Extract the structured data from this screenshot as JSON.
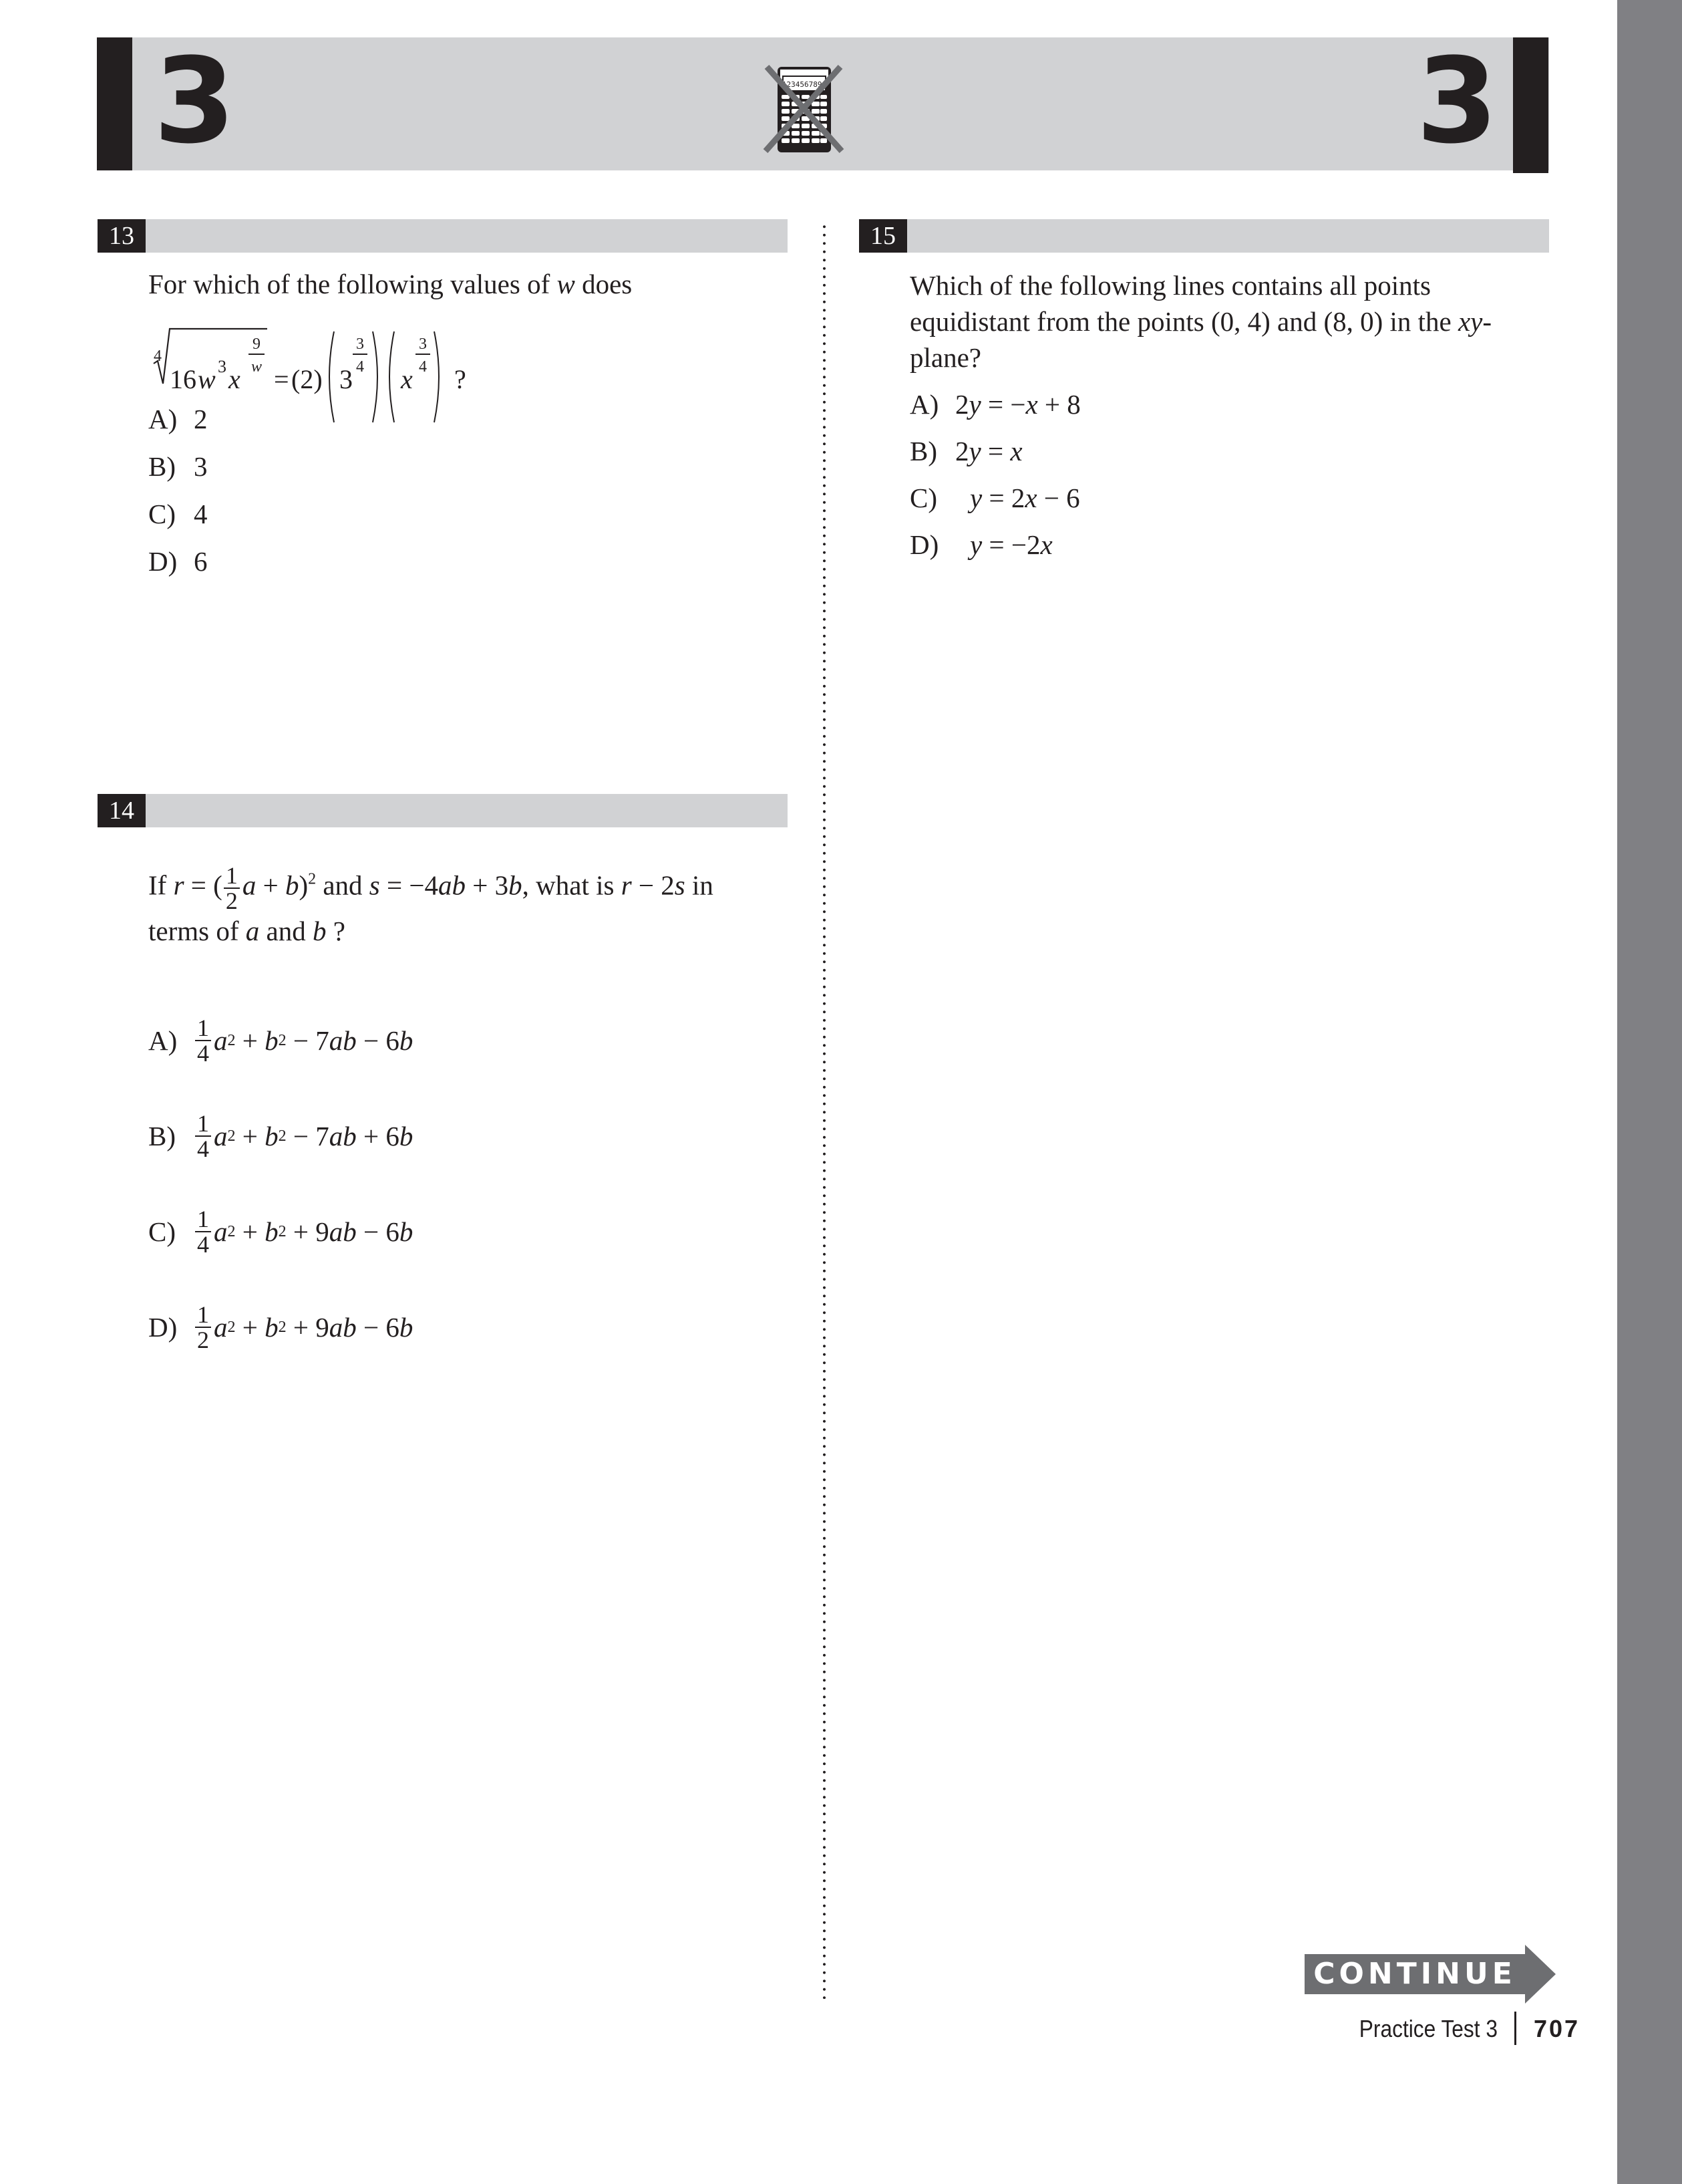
{
  "header": {
    "section_number_left": "3",
    "section_number_right": "3",
    "calculator_icon": "no-calculator-icon",
    "calculator_display": "1234567890"
  },
  "questions": [
    {
      "number": "13",
      "stem": "For which of the following values of w does",
      "stem_parts": [
        "For which of the following values of ",
        "w",
        " does"
      ],
      "equation": {
        "root_index": "4",
        "radicand_coefficient": "16",
        "radicand_var1": "w",
        "radicand_var1_exp": "3",
        "radicand_var2": "x",
        "radicand_var2_exp_num": "9",
        "radicand_var2_exp_den": "w",
        "equals": "=",
        "factor1": "(2)",
        "factor2_base": "3",
        "factor2_exp_num": "3",
        "factor2_exp_den": "4",
        "factor3_base": "x",
        "factor3_exp_num": "3",
        "factor3_exp_den": "4",
        "end": "?"
      },
      "choices": [
        {
          "label": "A)",
          "text": "2"
        },
        {
          "label": "B)",
          "text": "3"
        },
        {
          "label": "C)",
          "text": "4"
        },
        {
          "label": "D)",
          "text": "6"
        }
      ]
    },
    {
      "number": "14",
      "stem": "If r = (1/2 a + b)² and s = −4ab + 3b, what is r − 2s in terms of a and b ?",
      "stem_parts": {
        "p1": "If ",
        "r": "r",
        "p2": " = (",
        "frac_num": "1",
        "frac_den": "2",
        "a1": "a",
        "p3": " + ",
        "b1": "b",
        "p4": ")",
        "sq": "2",
        "p5": " and ",
        "s": "s",
        "p6": " = −4",
        "ab": "ab",
        "p7": " + 3",
        "b2": "b",
        "p8": ", what is ",
        "r2": "r",
        "p9": " − 2",
        "s2": "s",
        "p10": " in",
        "line2_a": "terms of ",
        "a2": "a",
        "line2_b": " and ",
        "b3": "b",
        "line2_c": " ?"
      },
      "choices": [
        {
          "label": "A)",
          "frac_num": "1",
          "frac_den": "4",
          "t1": "a",
          "t2": "2",
          "t3": " + ",
          "t4": "b",
          "t5": "2",
          "t6": " − 7",
          "t7": "ab",
          "t8": " − 6",
          "t9": "b"
        },
        {
          "label": "B)",
          "frac_num": "1",
          "frac_den": "4",
          "t1": "a",
          "t2": "2",
          "t3": " + ",
          "t4": "b",
          "t5": "2",
          "t6": " − 7",
          "t7": "ab",
          "t8": " + 6",
          "t9": "b"
        },
        {
          "label": "C)",
          "frac_num": "1",
          "frac_den": "4",
          "t1": "a",
          "t2": "2",
          "t3": " + ",
          "t4": "b",
          "t5": "2",
          "t6": " + 9",
          "t7": "ab",
          "t8": " − 6",
          "t9": "b"
        },
        {
          "label": "D)",
          "frac_num": "1",
          "frac_den": "2",
          "t1": "a",
          "t2": "2",
          "t3": " + ",
          "t4": "b",
          "t5": "2",
          "t6": " + 9",
          "t7": "ab",
          "t8": " − 6",
          "t9": "b"
        }
      ]
    },
    {
      "number": "15",
      "stem_lines": [
        "Which of the following lines contains all points",
        "equidistant from the points (0, 4) and (8, 0) in the ",
        "plane?"
      ],
      "stem_italic": "xy",
      "stem_hyphen": "-",
      "choices": [
        {
          "label": "A)",
          "lhs_coef": "2",
          "lhs_var": "y",
          "mid": " = −",
          "v1": "x",
          "rest": " + 8",
          "v2": ""
        },
        {
          "label": "B)",
          "lhs_coef": "2",
          "lhs_var": "y",
          "mid": " = ",
          "v1": "x",
          "rest": "",
          "v2": ""
        },
        {
          "label": "C)",
          "lhs_coef": "",
          "lhs_var": "y",
          "mid": " = 2",
          "v1": "x",
          "rest": " − 6",
          "v2": ""
        },
        {
          "label": "D)",
          "lhs_coef": "",
          "lhs_var": "y",
          "mid": " = −2",
          "v1": "x",
          "rest": "",
          "v2": ""
        }
      ]
    }
  ],
  "footer": {
    "continue_label": "CONTINUE",
    "book_section": "Practice Test 3",
    "page_number": "707"
  },
  "colors": {
    "banner_gray": "#d1d2d4",
    "dark": "#231f20",
    "side_strip": "#808084",
    "continue_gray": "#6d6e71"
  }
}
